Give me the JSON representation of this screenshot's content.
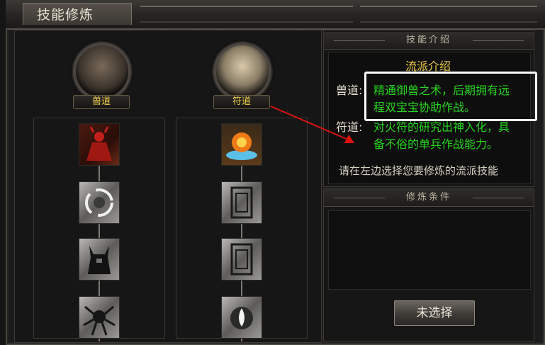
{
  "window": {
    "title": "技能修炼"
  },
  "factions": [
    {
      "name": "兽道"
    },
    {
      "name": "符道"
    }
  ],
  "sections": {
    "intro_header": "技能介绍",
    "condition_header": "修炼条件"
  },
  "intro": {
    "title": "流派介绍",
    "beast_label": "兽道:",
    "beast_desc_line1": "精通御兽之术，后期拥有远",
    "beast_desc_line2": "程双宝宝协助作战。",
    "talisman_label": "符道:",
    "talisman_desc_line1": "对火符的研究出神入化，具",
    "talisman_desc_line2": "备不俗的单兵作战能力。",
    "prompt": "请在左边选择您要修炼的流派技能"
  },
  "action_button": "未选择",
  "colors": {
    "gold": "#f0d04a",
    "green": "#27d31f",
    "highlight": "#ffffff",
    "arrow": "#e01010"
  },
  "skill_icons": {
    "beast": [
      "demon-summon-icon",
      "vortex-icon",
      "horned-knight-icon",
      "spider-beast-icon"
    ],
    "talisman": [
      "fire-blast-icon",
      "talisman-scroll-icon",
      "talisman-scroll-icon",
      "spirit-flame-icon"
    ]
  }
}
